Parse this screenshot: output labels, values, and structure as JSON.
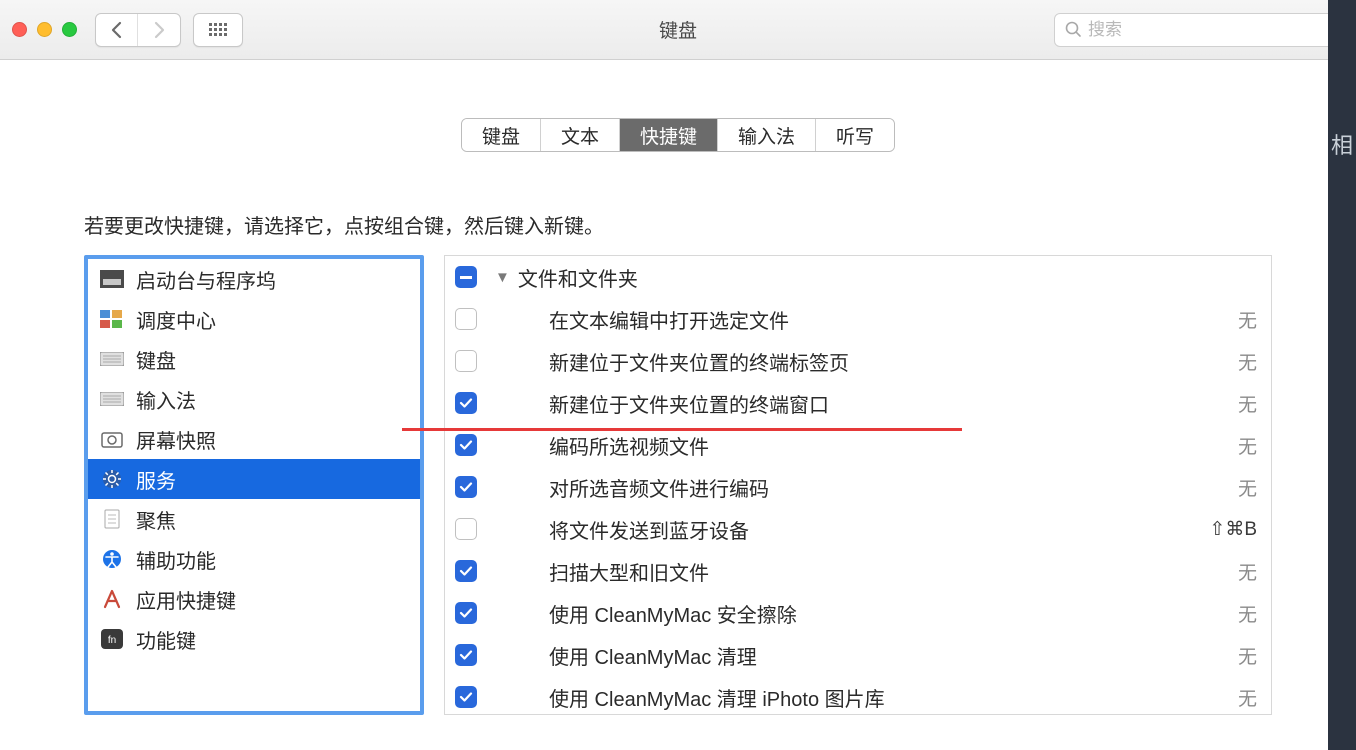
{
  "window": {
    "title": "键盘"
  },
  "search": {
    "placeholder": "搜索"
  },
  "tabs": [
    {
      "label": "键盘",
      "active": false
    },
    {
      "label": "文本",
      "active": false
    },
    {
      "label": "快捷键",
      "active": true
    },
    {
      "label": "输入法",
      "active": false
    },
    {
      "label": "听写",
      "active": false
    }
  ],
  "instruction": "若要更改快捷键，请选择它，点按组合键，然后键入新键。",
  "sidebar": {
    "items": [
      {
        "label": "启动台与程序坞",
        "icon": "launchpad",
        "selected": false
      },
      {
        "label": "调度中心",
        "icon": "mission-control",
        "selected": false
      },
      {
        "label": "键盘",
        "icon": "keyboard",
        "selected": false
      },
      {
        "label": "输入法",
        "icon": "keyboard",
        "selected": false
      },
      {
        "label": "屏幕快照",
        "icon": "camera",
        "selected": false
      },
      {
        "label": "服务",
        "icon": "gear",
        "selected": true
      },
      {
        "label": "聚焦",
        "icon": "document",
        "selected": false
      },
      {
        "label": "辅助功能",
        "icon": "accessibility",
        "selected": false
      },
      {
        "label": "应用快捷键",
        "icon": "a-icon",
        "selected": false
      },
      {
        "label": "功能键",
        "icon": "fn",
        "selected": false
      }
    ]
  },
  "services": {
    "header": {
      "label": "文件和文件夹",
      "state": "mixed"
    },
    "items": [
      {
        "label": "在文本编辑中打开选定文件",
        "checked": false,
        "shortcut": "无",
        "sc_none": true
      },
      {
        "label": "新建位于文件夹位置的终端标签页",
        "checked": false,
        "shortcut": "无",
        "sc_none": true
      },
      {
        "label": "新建位于文件夹位置的终端窗口",
        "checked": true,
        "shortcut": "无",
        "sc_none": true
      },
      {
        "label": "编码所选视频文件",
        "checked": true,
        "shortcut": "无",
        "sc_none": true
      },
      {
        "label": "对所选音频文件进行编码",
        "checked": true,
        "shortcut": "无",
        "sc_none": true
      },
      {
        "label": "将文件发送到蓝牙设备",
        "checked": false,
        "shortcut": "⇧⌘B",
        "sc_none": false
      },
      {
        "label": "扫描大型和旧文件",
        "checked": true,
        "shortcut": "无",
        "sc_none": true
      },
      {
        "label": "使用 CleanMyMac 安全擦除",
        "checked": true,
        "shortcut": "无",
        "sc_none": true
      },
      {
        "label": "使用 CleanMyMac 清理",
        "checked": true,
        "shortcut": "无",
        "sc_none": true
      },
      {
        "label": "使用 CleanMyMac 清理 iPhoto 图片库",
        "checked": true,
        "shortcut": "无",
        "sc_none": true
      }
    ]
  },
  "right_strip": "相"
}
